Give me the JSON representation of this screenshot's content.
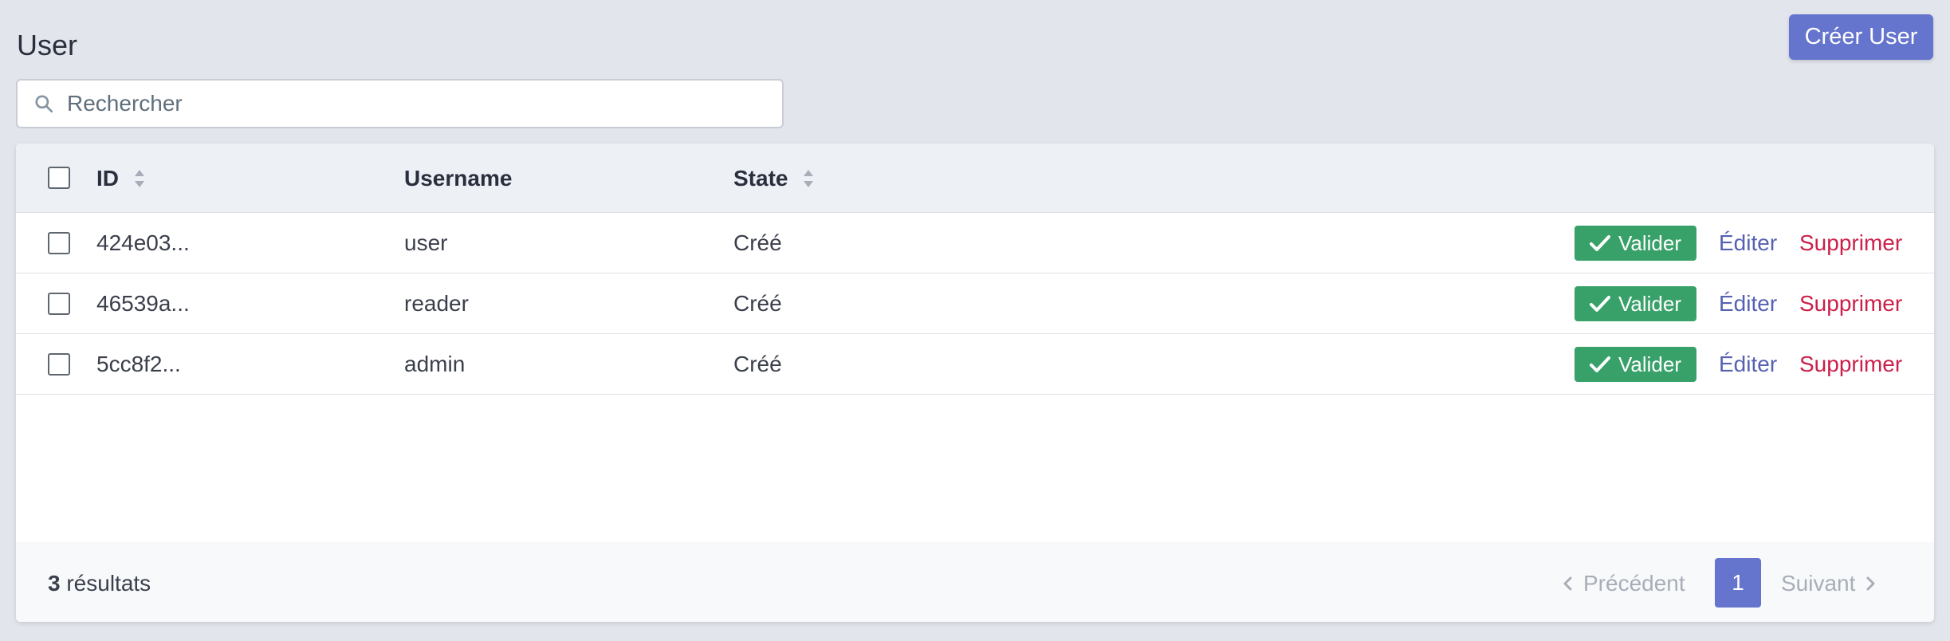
{
  "header": {
    "title": "User",
    "create_button_label": "Créer User"
  },
  "search": {
    "placeholder": "Rechercher",
    "value": "",
    "icon": "search-icon"
  },
  "table": {
    "columns": [
      {
        "label": "ID",
        "sortable": true
      },
      {
        "label": "Username",
        "sortable": false
      },
      {
        "label": "State",
        "sortable": true
      }
    ],
    "rows": [
      {
        "id": "424e03...",
        "username": "user",
        "state": "Créé",
        "validate_label": "Valider",
        "edit_label": "Éditer",
        "delete_label": "Supprimer"
      },
      {
        "id": "46539a...",
        "username": "reader",
        "state": "Créé",
        "validate_label": "Valider",
        "edit_label": "Éditer",
        "delete_label": "Supprimer"
      },
      {
        "id": "5cc8f2...",
        "username": "admin",
        "state": "Créé",
        "validate_label": "Valider",
        "edit_label": "Éditer",
        "delete_label": "Supprimer"
      }
    ]
  },
  "footer": {
    "results_count": "3",
    "results_label": "résultats",
    "prev_label": "Précédent",
    "current_page": "1",
    "next_label": "Suivant"
  },
  "colors": {
    "accent": "#6574cd",
    "success": "#38a169",
    "danger": "#cc1f4a",
    "link": "#5661b3"
  }
}
